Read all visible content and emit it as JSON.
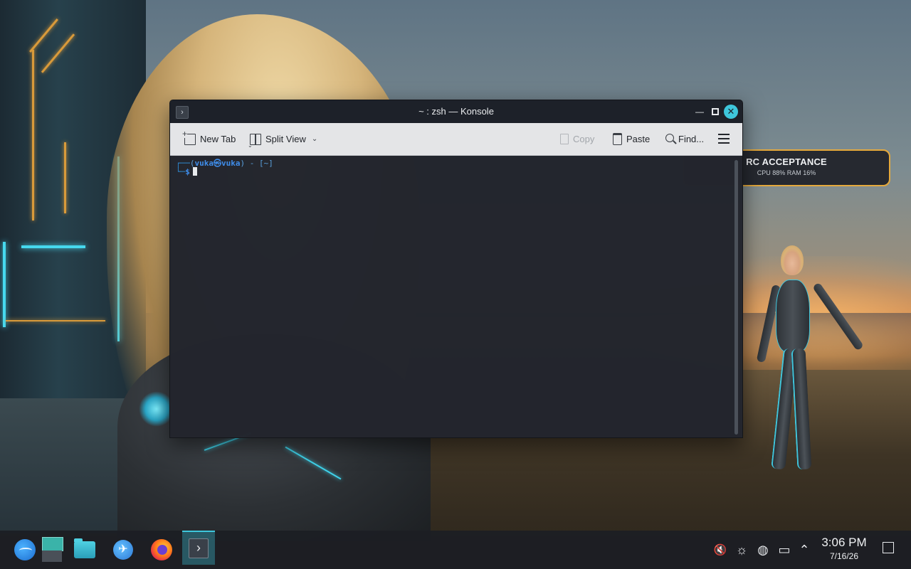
{
  "window": {
    "title": "~ : zsh — Konsole",
    "app_icon_glyph": "›",
    "minimize_glyph": "—",
    "close_glyph": "✕"
  },
  "toolbar": {
    "new_tab_label": "New Tab",
    "new_tab_sub": "⌄",
    "split_view_label": "Split View",
    "split_view_chevron": "⌄",
    "copy_label": "Copy",
    "paste_label": "Paste",
    "find_label": "Find..."
  },
  "terminal": {
    "line1_corner": "┌──",
    "line1_open": "(",
    "line1_user": "vuka㉿vuka",
    "line1_close": ")",
    "line1_dash": "-",
    "line1_dir": "[~]",
    "line2_corner": "└─",
    "line2_prompt": "$"
  },
  "widget": {
    "title": "RC ACCEPTANCE",
    "stats": "CPU 88%  RAM 16%"
  },
  "taskbar": {
    "plane_glyph": "✈",
    "konsole_glyph": "›",
    "volume_glyph": "🔇",
    "brightness_glyph": "☼",
    "network_glyph": "◍",
    "display_glyph": "▭",
    "expand_glyph": "⌃",
    "time": "3:06 PM",
    "date": "7/16/26"
  },
  "colors": {
    "accent": "#3ec7dc",
    "widget_border": "#e5a93c",
    "prompt_blue": "#3f8dea"
  }
}
